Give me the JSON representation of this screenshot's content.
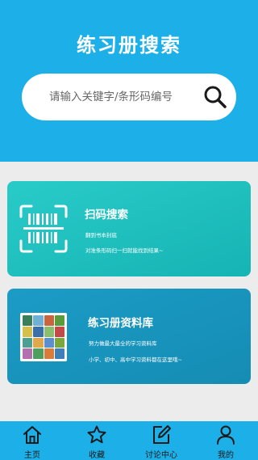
{
  "header": {
    "title": "练习册搜索",
    "search": {
      "placeholder": "请输入关键字/条形码编号",
      "value": ""
    }
  },
  "cards": {
    "scan": {
      "title": "扫码搜索",
      "line1": "翻到书本封底",
      "line2": "对准条形码扫一扫就能找到结果~"
    },
    "library": {
      "title": "练习册资料库",
      "line1": "努力做最大最全的学习资料库",
      "line2": "小学、初中、高中学习资料都在这里哦~",
      "thumbnail_colors": [
        "#3a7f5a",
        "#6fb0d6",
        "#c9643f",
        "#5a9c3c",
        "#d4c04a",
        "#3b6fa8",
        "#8cbf6d",
        "#c24a4a",
        "#4da08f",
        "#e0a84a",
        "#5b8fcf",
        "#7aa83d",
        "#b36fb0",
        "#4e9e5e",
        "#d97c3a",
        "#3f7fb8"
      ]
    }
  },
  "tabbar": {
    "items": [
      {
        "label": "主页",
        "icon": "home-icon"
      },
      {
        "label": "收藏",
        "icon": "star-icon"
      },
      {
        "label": "讨论中心",
        "icon": "edit-icon"
      },
      {
        "label": "我的",
        "icon": "user-icon"
      }
    ]
  },
  "colors": {
    "primary": "#1db0e8",
    "scan_card": "#22c2c1",
    "library_card": "#1895bf",
    "background": "#ececec"
  }
}
